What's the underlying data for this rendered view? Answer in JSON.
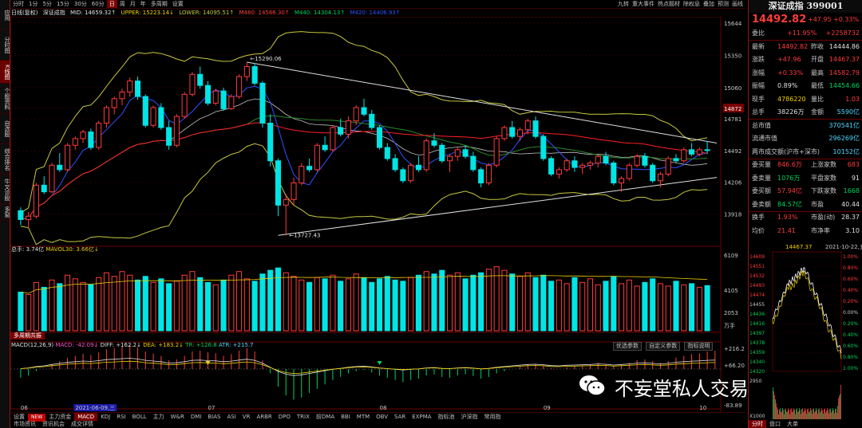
{
  "left_tabs": [
    "应用",
    "分时图",
    "K线图",
    "个股资料",
    "自选股",
    "综合排名",
    "牛叉诊股",
    "多窗"
  ],
  "period_tabs": [
    "分时",
    "1分",
    "5分",
    "15分",
    "30分",
    "60分",
    "日",
    "周",
    "月",
    "年",
    "多周期",
    "设置"
  ],
  "active_period": "日",
  "top_right_buttons": [
    "九转",
    "重大事件",
    "热点题材",
    "除权息",
    "叠加",
    "预测",
    "画线"
  ],
  "info_line": {
    "name": "日线(复权)",
    "boll_title": "深证成指",
    "mid": "MID: 14659.32↑",
    "upper": "UPPER: 15223.14↓",
    "lower": "LOWER: 14095.51↑",
    "ma60": "M480: 14566.30↑",
    "ma40": "M440: 14304.13↑",
    "ma20": "M420: 14406.93↑"
  },
  "price_axis": [
    "15644",
    "15350",
    "15060",
    "14872",
    "14781",
    "14492",
    "14206",
    "13918"
  ],
  "price_axis_highlight": "14872",
  "annotations": {
    "high": "15290.06",
    "low": "13727.43"
  },
  "volume_panel": {
    "label": "总手: 3.74亿",
    "mavol": "MAVOL30: 3.66亿↓",
    "axis": [
      "6109",
      "4105",
      "2053",
      "万手"
    ]
  },
  "signal_bar": {
    "label": "多周期共振"
  },
  "macd_panel": {
    "label": "MACD(12,26,9)",
    "macd": "MACD: -42.09↓",
    "diff": "DIFF: +162.2↓",
    "dea": "DEA: +183.2↓",
    "tr": "TR: +126.8",
    "atr": "ATR: +215.7",
    "axis": [
      "+216.2",
      "+66.20",
      "-83.89"
    ],
    "buttons": [
      "优选参数",
      "自定义参数",
      "指标说明"
    ]
  },
  "date_axis": [
    "06",
    "2021-06-09,三",
    "07",
    "08",
    "09",
    "10"
  ],
  "bottom_tabs": [
    "设置",
    "NEW",
    "主力资金",
    "MACD",
    "KDJ",
    "RSI",
    "BOLL",
    "主力",
    "W&R",
    "DMI",
    "BIAS",
    "ASI",
    "VR",
    "ARBR",
    "DPO",
    "TRIX",
    "前DMA",
    "BBI",
    "MTM",
    "OBV",
    "SAR",
    "EXPMA",
    "指标池",
    "沪深指",
    "常用指"
  ],
  "bottom_tabs2": [
    "市场资讯",
    "资讯机会",
    "成交详情"
  ],
  "active_bottom_tab": "MACD",
  "quote": {
    "title": "深证成指 399001",
    "price": "14492.82",
    "change": "+47.95",
    "pct": "+0.33%",
    "rows": [
      [
        {
          "t": "委比",
          "c": "lbl"
        },
        {
          "t": "+11.95%",
          "c": "red"
        },
        {
          "t": "+2258732",
          "c": "red"
        }
      ],
      [
        {
          "t": "最新",
          "c": "lbl"
        },
        {
          "t": "14492.82",
          "c": "red"
        },
        {
          "t": "昨收",
          "c": "lbl"
        },
        {
          "t": "14444.86",
          "c": "white"
        }
      ],
      [
        {
          "t": "涨跌",
          "c": "lbl"
        },
        {
          "t": "+47.96",
          "c": "red"
        },
        {
          "t": "开盘",
          "c": "lbl"
        },
        {
          "t": "14467.37",
          "c": "red"
        }
      ],
      [
        {
          "t": "涨幅",
          "c": "lbl"
        },
        {
          "t": "+0.33%",
          "c": "red"
        },
        {
          "t": "最高",
          "c": "lbl"
        },
        {
          "t": "14582.79",
          "c": "red"
        }
      ],
      [
        {
          "t": "振幅",
          "c": "lbl"
        },
        {
          "t": "0.89%",
          "c": "white"
        },
        {
          "t": "最低",
          "c": "lbl"
        },
        {
          "t": "14454.66",
          "c": "green"
        }
      ],
      [
        {
          "t": "现手",
          "c": "lbl"
        },
        {
          "t": "4786220",
          "c": "yellow"
        },
        {
          "t": "量比",
          "c": "lbl"
        },
        {
          "t": "1.03",
          "c": "red"
        }
      ],
      [
        {
          "t": "总手",
          "c": "lbl"
        },
        {
          "t": "38226万",
          "c": "white"
        },
        {
          "t": "金额",
          "c": "lbl"
        },
        {
          "t": "5590亿",
          "c": "cyan"
        }
      ],
      [
        {
          "t": "总市值",
          "c": "lbl"
        },
        {
          "t": "370541亿",
          "c": "cyan"
        }
      ],
      [
        {
          "t": "流通市值",
          "c": "lbl"
        },
        {
          "t": "296269亿",
          "c": "cyan"
        }
      ],
      [
        {
          "t": "两市成交额(沪市+深市)",
          "c": "lbl"
        },
        {
          "t": "10152亿",
          "c": "cyan"
        }
      ],
      [
        {
          "t": "委买量",
          "c": "lbl"
        },
        {
          "t": "846.6万",
          "c": "red"
        },
        {
          "t": "上涨家数",
          "c": "lbl"
        },
        {
          "t": "683",
          "c": "red"
        }
      ],
      [
        {
          "t": "委卖量",
          "c": "lbl"
        },
        {
          "t": "1076万",
          "c": "green"
        },
        {
          "t": "平盘家数",
          "c": "lbl"
        },
        {
          "t": "91",
          "c": "white"
        }
      ],
      [
        {
          "t": "委买额",
          "c": "lbl"
        },
        {
          "t": "57.94亿",
          "c": "red"
        },
        {
          "t": "下跌家数",
          "c": "lbl"
        },
        {
          "t": "1668",
          "c": "green"
        }
      ],
      [
        {
          "t": "委卖额",
          "c": "lbl"
        },
        {
          "t": "84.57亿",
          "c": "green"
        },
        {
          "t": "市盈",
          "c": "lbl"
        },
        {
          "t": "40.44",
          "c": "white"
        }
      ],
      [
        {
          "t": "换手",
          "c": "lbl"
        },
        {
          "t": "1.93%",
          "c": "red"
        },
        {
          "t": "市盈(动)",
          "c": "lbl"
        },
        {
          "t": "28.37",
          "c": "white"
        }
      ],
      [
        {
          "t": "均价",
          "c": "lbl"
        },
        {
          "t": "21.41",
          "c": "red"
        },
        {
          "t": "市净率",
          "c": "lbl"
        },
        {
          "t": "3.10",
          "c": "white"
        }
      ]
    ],
    "mini": {
      "header_price": "14467.37",
      "header_date": "2021-10-22,五",
      "left_axis": [
        "14609",
        "14551",
        "14532",
        "14493",
        "14474",
        "14455",
        "14436",
        "14416",
        "14397",
        "14378",
        "14359",
        "14340",
        "14320"
      ],
      "right_axis": [
        "1.00%",
        "0.80%",
        "0.60%",
        "0.40%",
        "0.20%",
        "0.00%",
        "0.20%",
        "0.40%",
        "0.60%",
        "0.80%",
        "1.00%"
      ],
      "vol_axis": [
        "2950",
        "X1000"
      ],
      "tabs": [
        "分时",
        "盘口",
        "大单"
      ]
    }
  },
  "watermark": "不妄堂私人交易俱乐部",
  "colors": {
    "up": "#ff3b3b",
    "down": "#00e5e5",
    "cyan_candle": "#00e5e5",
    "bg": "#000000",
    "frame": "#8b1a1a",
    "boll_upper": "#c8c840",
    "boll_mid": "#c8c8c8",
    "ma_blue": "#3050ff",
    "ma_red": "#ff2020",
    "ma_green": "#2a8a2a"
  },
  "chart_data": {
    "type": "candlestick",
    "title": "深证成指",
    "ohlc": [
      [
        13950,
        13980,
        13820,
        13870
      ],
      [
        13870,
        13940,
        13800,
        13900
      ],
      [
        13900,
        14200,
        13880,
        14180
      ],
      [
        14180,
        14260,
        14100,
        14120
      ],
      [
        14120,
        14380,
        14110,
        14360
      ],
      [
        14360,
        14470,
        14300,
        14320
      ],
      [
        14320,
        14560,
        14300,
        14540
      ],
      [
        14540,
        14620,
        14500,
        14600
      ],
      [
        14600,
        14680,
        14560,
        14660
      ],
      [
        14660,
        14690,
        14500,
        14520
      ],
      [
        14520,
        14760,
        14500,
        14740
      ],
      [
        14740,
        14900,
        14700,
        14880
      ],
      [
        14880,
        14980,
        14820,
        14960
      ],
      [
        14960,
        15050,
        14900,
        15020
      ],
      [
        15020,
        15150,
        14980,
        15120
      ],
      [
        15120,
        15160,
        14950,
        14980
      ],
      [
        14980,
        15000,
        14700,
        14720
      ],
      [
        14720,
        14900,
        14700,
        14880
      ],
      [
        14880,
        14920,
        14680,
        14700
      ],
      [
        14700,
        14760,
        14500,
        14540
      ],
      [
        14540,
        14820,
        14520,
        14800
      ],
      [
        14800,
        15020,
        14780,
        15000
      ],
      [
        15000,
        15200,
        14980,
        15180
      ],
      [
        15180,
        15250,
        15050,
        15080
      ],
      [
        15080,
        15120,
        14900,
        14920
      ],
      [
        14920,
        15050,
        14900,
        15030
      ],
      [
        15030,
        15060,
        14850,
        14870
      ],
      [
        14870,
        15000,
        14860,
        14980
      ],
      [
        14980,
        15180,
        14960,
        15160
      ],
      [
        15160,
        15290,
        15120,
        15250
      ],
      [
        15250,
        15280,
        15080,
        15100
      ],
      [
        15100,
        15120,
        14700,
        14740
      ],
      [
        14740,
        14820,
        14350,
        14400
      ],
      [
        14400,
        14420,
        13900,
        14000
      ],
      [
        14000,
        14100,
        13727,
        14050
      ],
      [
        14050,
        14250,
        14000,
        14200
      ],
      [
        14200,
        14380,
        14180,
        14350
      ],
      [
        14350,
        14420,
        14300,
        14320
      ],
      [
        14320,
        14560,
        14300,
        14540
      ],
      [
        14540,
        14620,
        14480,
        14500
      ],
      [
        14500,
        14720,
        14480,
        14700
      ],
      [
        14700,
        14780,
        14620,
        14640
      ],
      [
        14640,
        14800,
        14600,
        14760
      ],
      [
        14760,
        14900,
        14720,
        14880
      ],
      [
        14880,
        14960,
        14800,
        14820
      ],
      [
        14820,
        14860,
        14680,
        14700
      ],
      [
        14700,
        14720,
        14500,
        14520
      ],
      [
        14520,
        14560,
        14400,
        14420
      ],
      [
        14420,
        14460,
        14300,
        14320
      ],
      [
        14320,
        14340,
        14200,
        14220
      ],
      [
        14220,
        14380,
        14200,
        14360
      ],
      [
        14360,
        14440,
        14300,
        14320
      ],
      [
        14320,
        14600,
        14300,
        14580
      ],
      [
        14580,
        14650,
        14520,
        14540
      ],
      [
        14540,
        14560,
        14380,
        14400
      ],
      [
        14400,
        14460,
        14300,
        14440
      ],
      [
        14440,
        14520,
        14400,
        14500
      ],
      [
        14500,
        14540,
        14420,
        14440
      ],
      [
        14440,
        14480,
        14300,
        14320
      ],
      [
        14320,
        14340,
        14160,
        14200
      ],
      [
        14200,
        14380,
        14180,
        14360
      ],
      [
        14360,
        14620,
        14340,
        14600
      ],
      [
        14600,
        14720,
        14580,
        14700
      ],
      [
        14700,
        14760,
        14600,
        14620
      ],
      [
        14620,
        14700,
        14580,
        14680
      ],
      [
        14680,
        14780,
        14640,
        14760
      ],
      [
        14760,
        14800,
        14600,
        14620
      ],
      [
        14620,
        14640,
        14400,
        14420
      ],
      [
        14420,
        14440,
        14260,
        14280
      ],
      [
        14280,
        14340,
        14240,
        14320
      ],
      [
        14320,
        14420,
        14300,
        14400
      ],
      [
        14400,
        14440,
        14300,
        14340
      ],
      [
        14340,
        14380,
        14280,
        14360
      ],
      [
        14360,
        14400,
        14320,
        14380
      ],
      [
        14380,
        14460,
        14340,
        14440
      ],
      [
        14440,
        14480,
        14360,
        14380
      ],
      [
        14380,
        14400,
        14180,
        14200
      ],
      [
        14200,
        14260,
        14120,
        14240
      ],
      [
        14240,
        14380,
        14220,
        14360
      ],
      [
        14360,
        14460,
        14340,
        14440
      ],
      [
        14440,
        14470,
        14340,
        14360
      ],
      [
        14360,
        14380,
        14200,
        14220
      ],
      [
        14220,
        14300,
        14160,
        14280
      ],
      [
        14280,
        14440,
        14260,
        14420
      ],
      [
        14420,
        14460,
        14380,
        14400
      ],
      [
        14400,
        14520,
        14380,
        14500
      ],
      [
        14500,
        14560,
        14440,
        14460
      ],
      [
        14460,
        14520,
        14440,
        14500
      ],
      [
        14500,
        14580,
        14460,
        14493
      ]
    ],
    "volume": [
      3.2,
      3.0,
      4.0,
      3.6,
      4.2,
      3.9,
      4.6,
      4.3,
      4.0,
      3.8,
      4.4,
      4.8,
      4.5,
      4.9,
      4.6,
      4.2,
      4.5,
      4.0,
      4.3,
      3.9,
      4.1,
      4.6,
      4.9,
      4.4,
      4.0,
      3.8,
      4.2,
      4.6,
      4.9,
      4.3,
      4.1,
      4.7,
      5.0,
      5.2,
      4.8,
      4.5,
      4.2,
      4.0,
      4.4,
      4.3,
      4.6,
      4.1,
      4.3,
      4.7,
      4.4,
      4.0,
      4.3,
      4.5,
      4.2,
      4.1,
      4.4,
      4.6,
      4.9,
      4.7,
      5.0,
      4.6,
      4.8,
      4.3,
      4.6,
      4.8,
      5.1,
      5.3,
      5.0,
      4.7,
      4.5,
      4.8,
      4.4,
      4.6,
      4.1,
      4.2,
      3.9,
      4.4,
      4.0,
      4.3,
      3.8,
      4.1,
      4.5,
      3.9,
      4.2,
      3.7,
      4.0,
      4.3,
      3.9,
      3.7,
      4.1,
      3.8,
      3.9,
      3.6,
      3.74
    ],
    "macd_hist": [
      -20,
      -15,
      -5,
      0,
      10,
      18,
      25,
      30,
      35,
      32,
      38,
      45,
      48,
      52,
      55,
      50,
      40,
      35,
      30,
      20,
      22,
      30,
      40,
      42,
      38,
      36,
      30,
      34,
      42,
      48,
      40,
      20,
      -10,
      -40,
      -60,
      -70,
      -65,
      -55,
      -45,
      -35,
      -25,
      -18,
      -10,
      -5,
      -2,
      -8,
      -15,
      -20,
      -25,
      -30,
      -25,
      -22,
      -15,
      -12,
      -18,
      -20,
      -15,
      -12,
      -16,
      -22,
      -18,
      -10,
      -5,
      0,
      5,
      10,
      12,
      8,
      2,
      0,
      4,
      6,
      8,
      10,
      14,
      12,
      6,
      10,
      14,
      20,
      22,
      18,
      14,
      18,
      26,
      30,
      34,
      36,
      40,
      42
    ]
  }
}
